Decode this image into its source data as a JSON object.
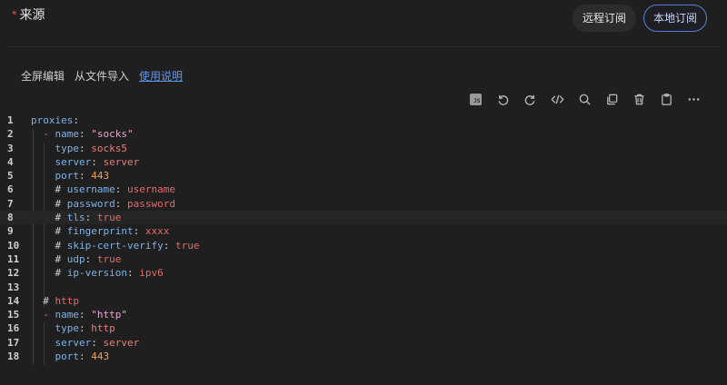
{
  "header": {
    "required_mark": "*",
    "source_label": "来源",
    "remote_button": "远程订阅",
    "local_button": "本地订阅"
  },
  "links": {
    "fullscreen": "全屏编辑",
    "import_file": "从文件导入",
    "help": "使用说明"
  },
  "toolbar_icons": [
    "js-icon",
    "undo-icon",
    "redo-icon",
    "code-icon",
    "search-icon",
    "copy-icon",
    "trash-icon",
    "clipboard-icon",
    "more-icon"
  ],
  "editor": {
    "line_numbers": [
      "1",
      "2",
      "3",
      "4",
      "5",
      "6",
      "7",
      "8",
      "9",
      "10",
      "11",
      "12",
      "13",
      "14",
      "15",
      "16",
      "17",
      "18"
    ],
    "active_line": 8
  },
  "code": {
    "l1_key": "proxies",
    "l2_dash": "- ",
    "l2_key": "name",
    "l2_val": "\"socks\"",
    "l3_key": "type",
    "l3_val": "socks5",
    "l4_key": "server",
    "l4_val": "server",
    "l5_key": "port",
    "l5_val": "443",
    "l6_hash": "# ",
    "l6_key": "username",
    "l6_val": "username",
    "l7_hash": "# ",
    "l7_key": "password",
    "l7_val": "password",
    "l8_hash": "# ",
    "l8_key": "tls",
    "l8_val": "true",
    "l9_hash": "# ",
    "l9_key": "fingerprint",
    "l9_val": "xxxx",
    "l10_hash": "# ",
    "l10_key": "skip-cert-verify",
    "l10_val": "true",
    "l11_hash": "# ",
    "l11_key": "udp",
    "l11_val": "true",
    "l12_hash": "# ",
    "l12_key": "ip-version",
    "l12_val": "ipv6",
    "l14_hash": "# ",
    "l14_val": "http",
    "l15_dash": "- ",
    "l15_key": "name",
    "l15_val": "\"http\"",
    "l16_key": "type",
    "l16_val": "http",
    "l17_key": "server",
    "l17_val": "server",
    "l18_key": "port",
    "l18_val": "443"
  }
}
